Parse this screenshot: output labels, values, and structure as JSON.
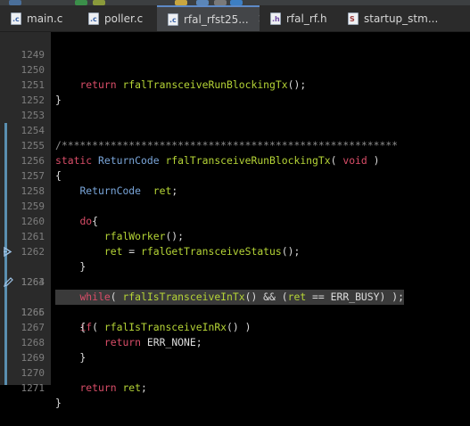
{
  "tabs": [
    {
      "label": "main.c",
      "icon": "c-file-icon",
      "active": false
    },
    {
      "label": "poller.c",
      "icon": "c-file-icon",
      "active": false
    },
    {
      "label": "rfal_rfst25...",
      "icon": "c-file-icon",
      "active": true
    },
    {
      "label": "rfal_rf.h",
      "icon": "h-file-icon",
      "active": false
    },
    {
      "label": "startup_stm...",
      "icon": "s-file-icon",
      "active": false
    }
  ],
  "file_icon_letters": {
    "c": ".c",
    "h": ".h",
    "s": "S"
  },
  "close_glyph": "×",
  "colors": {
    "keyword": "#d94d68",
    "type": "#7aa6da",
    "function": "#b5d436",
    "plain": "#dcdcdc",
    "line_number": "#7e7e7e",
    "background": "#000000",
    "highlight_line": "#3a3a3a"
  },
  "code_lines": [
    {
      "n": "1249",
      "text": "        "
    },
    {
      "n": "1250",
      "text": "    return rfalTransceiveRunBlockingTx();"
    },
    {
      "n": "1251",
      "text": "}"
    },
    {
      "n": "1252",
      "text": ""
    },
    {
      "n": "1253",
      "text": ""
    },
    {
      "n": "1254",
      "text": "/*******************************************************"
    },
    {
      "n": "1255",
      "text": "static ReturnCode rfalTransceiveRunBlockingTx( void )"
    },
    {
      "n": "1256",
      "text": "{"
    },
    {
      "n": "1257",
      "text": "    ReturnCode  ret;"
    },
    {
      "n": "1258",
      "text": ""
    },
    {
      "n": "1259",
      "text": "    do{"
    },
    {
      "n": "1260",
      "text": "        rfalWorker();"
    },
    {
      "n": "1261",
      "text": "        ret = rfalGetTransceiveStatus();"
    },
    {
      "n": "1262",
      "text": "    }"
    },
    {
      "n": "1263",
      "text": "    while( rfalIsTransceiveInTx() && (ret == ERR_BUSY) );"
    },
    {
      "n": "1264",
      "text": ""
    },
    {
      "n": "1265",
      "text": "    if( rfalIsTransceiveInRx() )"
    },
    {
      "n": "1266",
      "text": "    {"
    },
    {
      "n": "1267",
      "text": "        return ERR_NONE;"
    },
    {
      "n": "1268",
      "text": "    }"
    },
    {
      "n": "1269",
      "text": ""
    },
    {
      "n": "1270",
      "text": "    return ret;"
    },
    {
      "n": "1271",
      "text": "}"
    }
  ]
}
